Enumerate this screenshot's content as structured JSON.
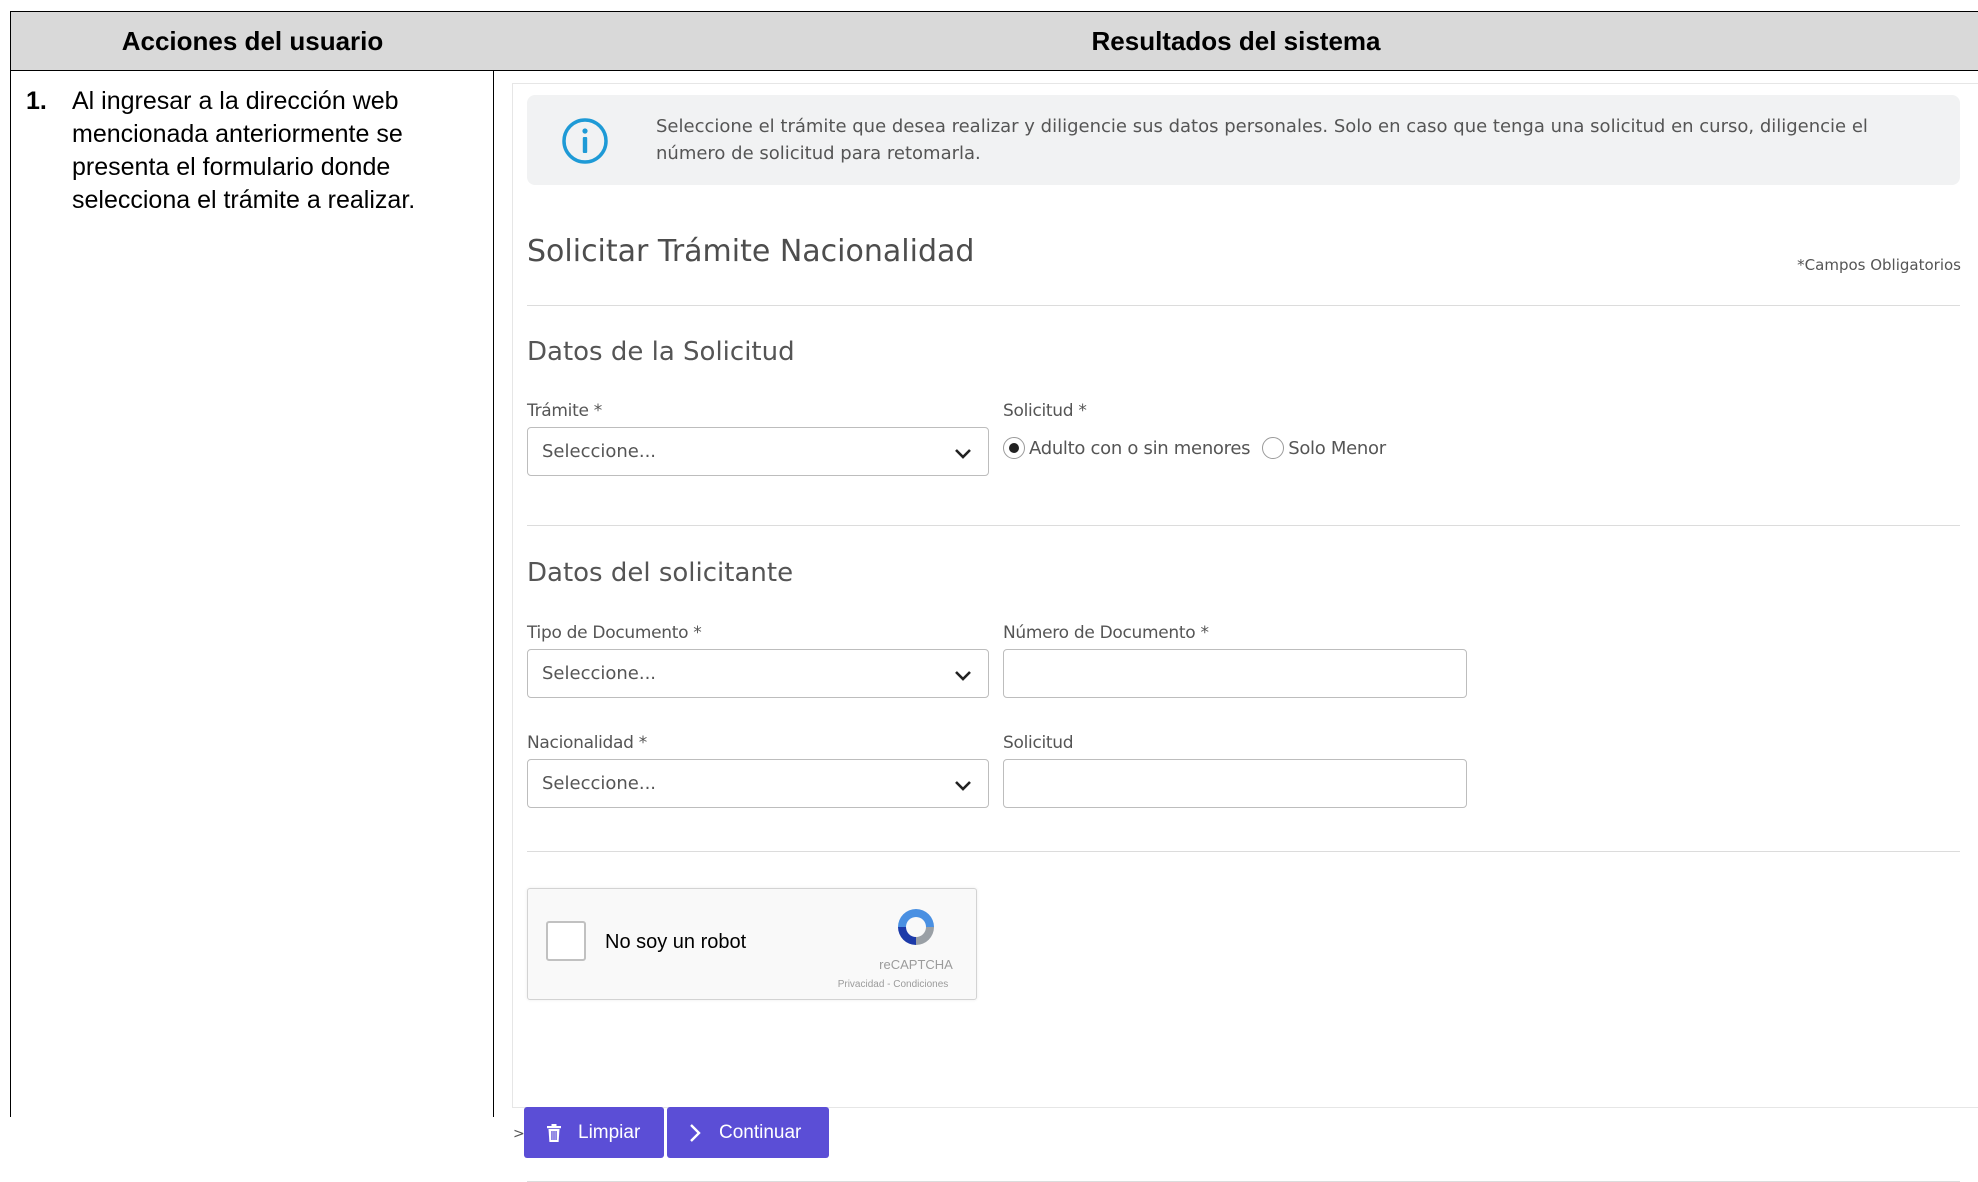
{
  "table": {
    "header_left": "Acciones del usuario",
    "header_right": "Resultados del sistema",
    "step_number": "1.",
    "step_text": "Al ingresar a la dirección web mencionada anteriormente se presenta el formulario donde selecciona el trámite a realizar."
  },
  "form": {
    "info_text": "Seleccione el trámite que desea realizar y diligencie sus datos personales. Solo en caso que tenga una solicitud en curso, diligencie el número de solicitud para retomarla.",
    "title": "Solicitar Trámite Nacionalidad",
    "required_note": "*Campos Obligatorios",
    "section_request": {
      "title": "Datos de la Solicitud",
      "tramite_label": "Trámite *",
      "tramite_value": "Seleccione...",
      "solicitud_label": "Solicitud *",
      "radio_options": [
        "Adulto con o sin menores",
        "Solo Menor"
      ],
      "radio_selected": "Adulto con o sin menores"
    },
    "section_applicant": {
      "title": "Datos del solicitante",
      "doc_type_label": "Tipo de Documento *",
      "doc_type_value": "Seleccione...",
      "doc_number_label": "Número de Documento *",
      "doc_number_value": "",
      "nationality_label": "Nacionalidad *",
      "nationality_value": "Seleccione...",
      "request_label": "Solicitud",
      "request_value": ""
    },
    "captcha": {
      "label": "No soy un robot",
      "brand": "reCAPTCHA",
      "links": "Privacidad - Condiciones"
    },
    "prefix_mark": ">",
    "buttons": {
      "clear": "Limpiar",
      "continue": "Continuar"
    }
  },
  "colors": {
    "primary_button": "#5b4ed6",
    "info_icon": "#1e9ad6",
    "header_bg": "#d9d9d9"
  },
  "icons": [
    "info-icon",
    "chevron-down-icon",
    "trash-icon",
    "chevron-right-icon",
    "recaptcha-logo-icon"
  ]
}
